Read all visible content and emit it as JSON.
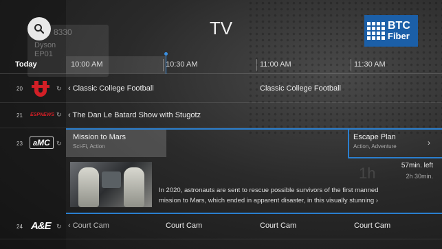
{
  "header": {
    "title": "TV",
    "logo": {
      "line1": "BTC",
      "line2": "Fiber"
    },
    "behind": {
      "line1": "8330",
      "line2": "Dyson",
      "line3": "EP01"
    }
  },
  "timebar": {
    "today": "Today",
    "slots": [
      "10:00 AM",
      "10:30 AM",
      "11:00 AM",
      "11:30 AM"
    ]
  },
  "rows": [
    {
      "number": "20",
      "network": "ESPNU",
      "cells": [
        "Classic College Football",
        "Classic College Football"
      ]
    },
    {
      "number": "21",
      "network": "ESPNEWS",
      "cells": [
        "The Dan Le Batard Show with Stugotz"
      ]
    },
    {
      "number": "23",
      "network": "amc",
      "focus": {
        "title": "Mission to Mars",
        "genre": "Sci-Fi, Action"
      },
      "next": {
        "title": "Escape Plan",
        "genre": "Action, Adventure"
      },
      "detail": {
        "time_left": "57min. left",
        "duration": "2h 30min.",
        "description_line1": "In 2020, astronauts are sent to rescue possible survivors of the first manned",
        "description_line2": "mission to Mars, which ended in apparent disaster, in this visually stunning ›"
      }
    },
    {
      "number": "24",
      "network": "A&E",
      "cells": [
        "Court Cam",
        "Court Cam",
        "Court Cam",
        "Court Cam"
      ]
    }
  ],
  "colors": {
    "accent": "#2a7fcf",
    "logo_bg": "#1b5fa8",
    "espn_red": "#d21f26"
  }
}
